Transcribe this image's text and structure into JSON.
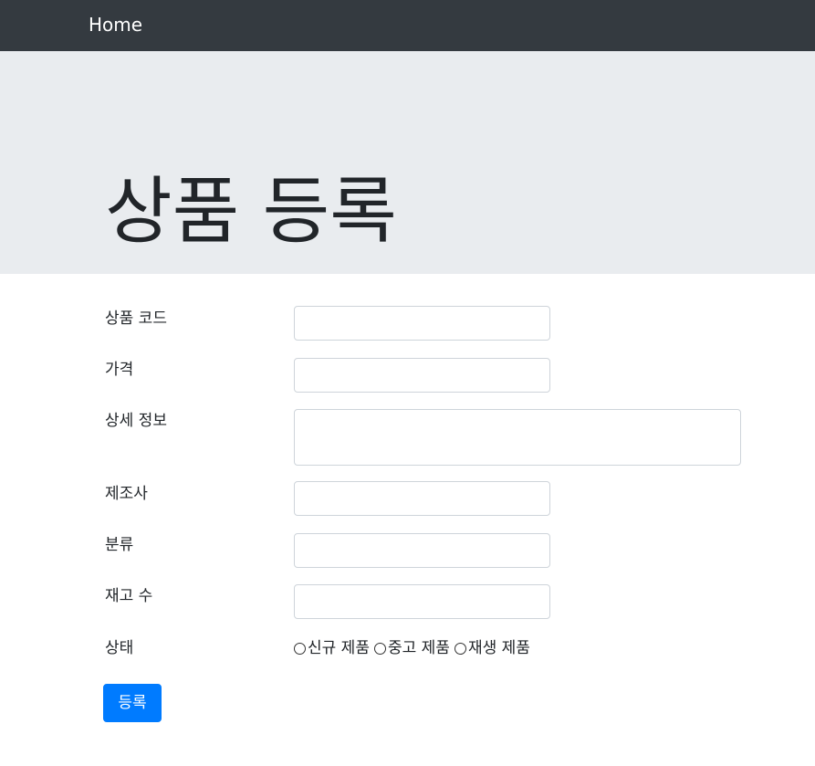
{
  "navbar": {
    "brand": "Home"
  },
  "jumbotron": {
    "title": "상품 등록"
  },
  "form": {
    "fields": [
      {
        "label": "상품 코드",
        "value": ""
      },
      {
        "label": "가격",
        "value": ""
      },
      {
        "label": "상세 정보",
        "value": ""
      },
      {
        "label": "제조사",
        "value": ""
      },
      {
        "label": "분류",
        "value": ""
      },
      {
        "label": "재고 수",
        "value": ""
      }
    ],
    "condition": {
      "label": "상태",
      "options": [
        "신규 제품",
        "중고 제품",
        "재생 제품"
      ]
    },
    "submit_label": "등록"
  },
  "colors": {
    "navbar_bg": "#343a40",
    "jumbotron_bg": "#e9ecef",
    "primary": "#007bff"
  }
}
